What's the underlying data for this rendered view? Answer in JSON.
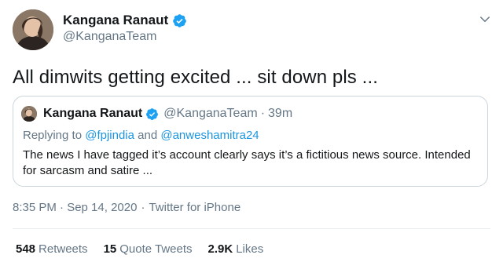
{
  "tweet": {
    "author_name": "Kangana Ranaut",
    "author_handle": "@KanganaTeam",
    "text": "All dimwits getting excited ... sit down pls ...",
    "timestamp": "8:35 PM · Sep 14, 2020",
    "source": "Twitter for iPhone",
    "verified_icon": "verified-badge-icon",
    "menu_icon": "chevron-down-icon"
  },
  "quote": {
    "author_name": "Kangana Ranaut",
    "author_handle": "@KanganaTeam",
    "separator": "·",
    "time_ago": "39m",
    "replying_prefix": "Replying to",
    "mention_1": "@fpjindia",
    "replying_and": "and",
    "mention_2": "@anweshamitra24",
    "text": "The news I have tagged it’s account clearly says it’s a fictitious news source. Intended for sarcasm and satire ..."
  },
  "stats": {
    "retweets_count": "548",
    "retweets_label": "Retweets",
    "quote_tweets_count": "15",
    "quote_tweets_label": "Quote Tweets",
    "likes_count": "2.9K",
    "likes_label": "Likes"
  },
  "colors": {
    "verified": "#1da1f2",
    "link": "#1b95e0",
    "secondary_text": "#657786",
    "border": "#ccd6dd"
  }
}
